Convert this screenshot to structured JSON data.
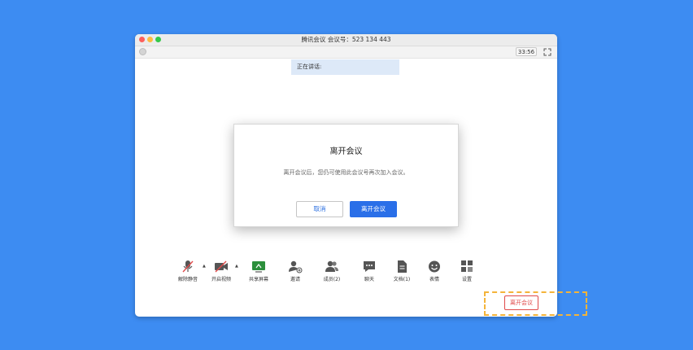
{
  "window": {
    "title": "腾讯会议 会议号：523 134 443"
  },
  "toolbar_top": {
    "timer": "33:56"
  },
  "speaking_banner": {
    "label": "正在讲话:"
  },
  "dialog": {
    "title": "离开会议",
    "message": "离开会议后，您仍可使用此会议号再次加入会议。",
    "cancel_label": "取消",
    "confirm_label": "离开会议"
  },
  "bottom_bar": {
    "items": [
      {
        "label": "解除静音",
        "icon": "mic-muted-icon"
      },
      {
        "label": "开启视频",
        "icon": "video-off-icon"
      },
      {
        "label": "共享屏幕",
        "icon": "screen-share-icon"
      },
      {
        "label": "邀请",
        "icon": "invite-icon"
      },
      {
        "label": "成员(2)",
        "icon": "members-icon"
      },
      {
        "label": "聊天",
        "icon": "chat-icon"
      },
      {
        "label": "文档(1)",
        "icon": "document-icon"
      },
      {
        "label": "表情",
        "icon": "emoji-icon"
      },
      {
        "label": "设置",
        "icon": "settings-icon"
      }
    ],
    "leave_label": "离开会议"
  },
  "colors": {
    "background": "#3d8cf2",
    "primary": "#2a6fe8",
    "danger": "#e04a4a",
    "highlight": "#f4b43a"
  }
}
